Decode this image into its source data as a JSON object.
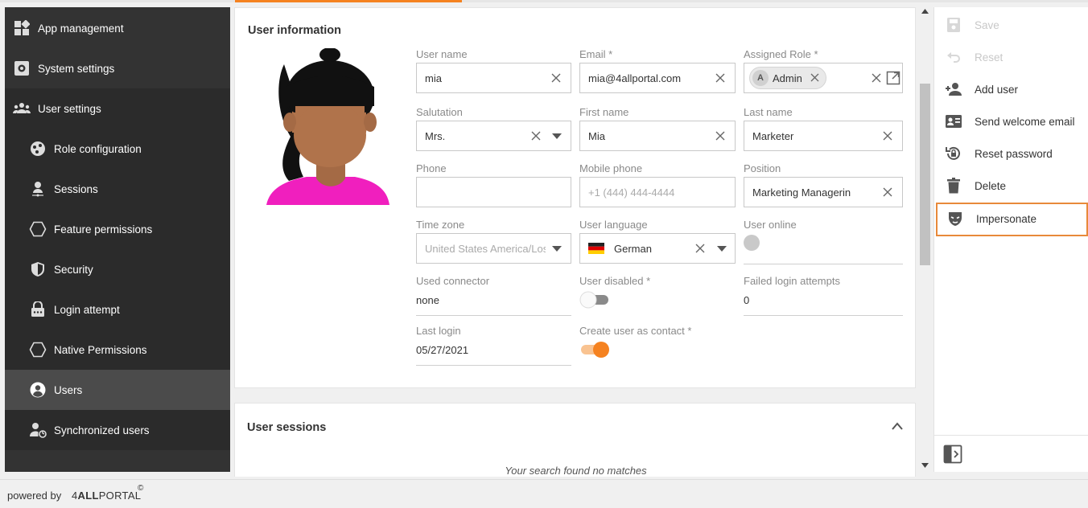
{
  "sidebar": {
    "items": [
      {
        "label": "App management",
        "icon": "app-management-icon"
      },
      {
        "label": "System settings",
        "icon": "system-settings-icon"
      },
      {
        "label": "User settings",
        "icon": "user-group-icon"
      },
      {
        "label": "Role configuration",
        "icon": "role-config-icon"
      },
      {
        "label": "Sessions",
        "icon": "sessions-icon"
      },
      {
        "label": "Feature permissions",
        "icon": "hexagon-icon"
      },
      {
        "label": "Security",
        "icon": "shield-icon"
      },
      {
        "label": "Login attempt",
        "icon": "lock-icon"
      },
      {
        "label": "Native Permissions",
        "icon": "hexagon-icon"
      },
      {
        "label": "Users",
        "icon": "user-circle-icon"
      },
      {
        "label": "Synchronized users",
        "icon": "user-sync-icon"
      }
    ]
  },
  "user_info": {
    "title": "User information",
    "fields": {
      "user_name": {
        "label": "User name",
        "value": "mia"
      },
      "email": {
        "label": "Email *",
        "value": "mia@4allportal.com"
      },
      "assigned_role": {
        "label": "Assigned Role *",
        "chip_initial": "A",
        "chip_label": "Admin"
      },
      "salutation": {
        "label": "Salutation",
        "value": "Mrs."
      },
      "first_name": {
        "label": "First name",
        "value": "Mia"
      },
      "last_name": {
        "label": "Last name",
        "value": "Marketer"
      },
      "phone": {
        "label": "Phone",
        "value": ""
      },
      "mobile_phone": {
        "label": "Mobile phone",
        "placeholder": "+1 (444) 444-4444"
      },
      "position": {
        "label": "Position",
        "value": "Marketing Managerin"
      },
      "time_zone": {
        "label": "Time zone",
        "placeholder": "United States America/Los_Angeles"
      },
      "user_language": {
        "label": "User language",
        "value": "German"
      },
      "user_online": {
        "label": "User online"
      },
      "used_connector": {
        "label": "Used connector",
        "value": "none"
      },
      "user_disabled": {
        "label": "User disabled *",
        "on": false
      },
      "failed_login_attempts": {
        "label": "Failed login attempts",
        "value": "0"
      },
      "last_login": {
        "label": "Last login",
        "value": "05/27/2021"
      },
      "create_as_contact": {
        "label": "Create user as contact *",
        "on": true
      }
    }
  },
  "sessions": {
    "title": "User sessions",
    "empty_text": "Your search found no matches"
  },
  "actions": [
    {
      "label": "Save",
      "icon": "save-icon",
      "disabled": true
    },
    {
      "label": "Reset",
      "icon": "undo-icon",
      "disabled": true
    },
    {
      "label": "Add user",
      "icon": "add-user-icon",
      "disabled": false
    },
    {
      "label": "Send welcome email",
      "icon": "contact-card-icon",
      "disabled": false
    },
    {
      "label": "Reset password",
      "icon": "lock-reset-icon",
      "disabled": false
    },
    {
      "label": "Delete",
      "icon": "trash-icon",
      "disabled": false
    },
    {
      "label": "Impersonate",
      "icon": "mask-icon",
      "disabled": false,
      "highlighted": true
    }
  ],
  "footer": {
    "powered_by": "powered by",
    "brand_prefix": "4",
    "brand_bold": "ALL",
    "brand_rest": "PORTAL",
    "brand_mark": "©"
  },
  "colors": {
    "accent": "#f58220",
    "sidebar_bg": "#333333",
    "sidebar_active": "#4b4b4b",
    "highlight_border": "#e8893a",
    "avatar_shirt": "#f01fbe"
  }
}
